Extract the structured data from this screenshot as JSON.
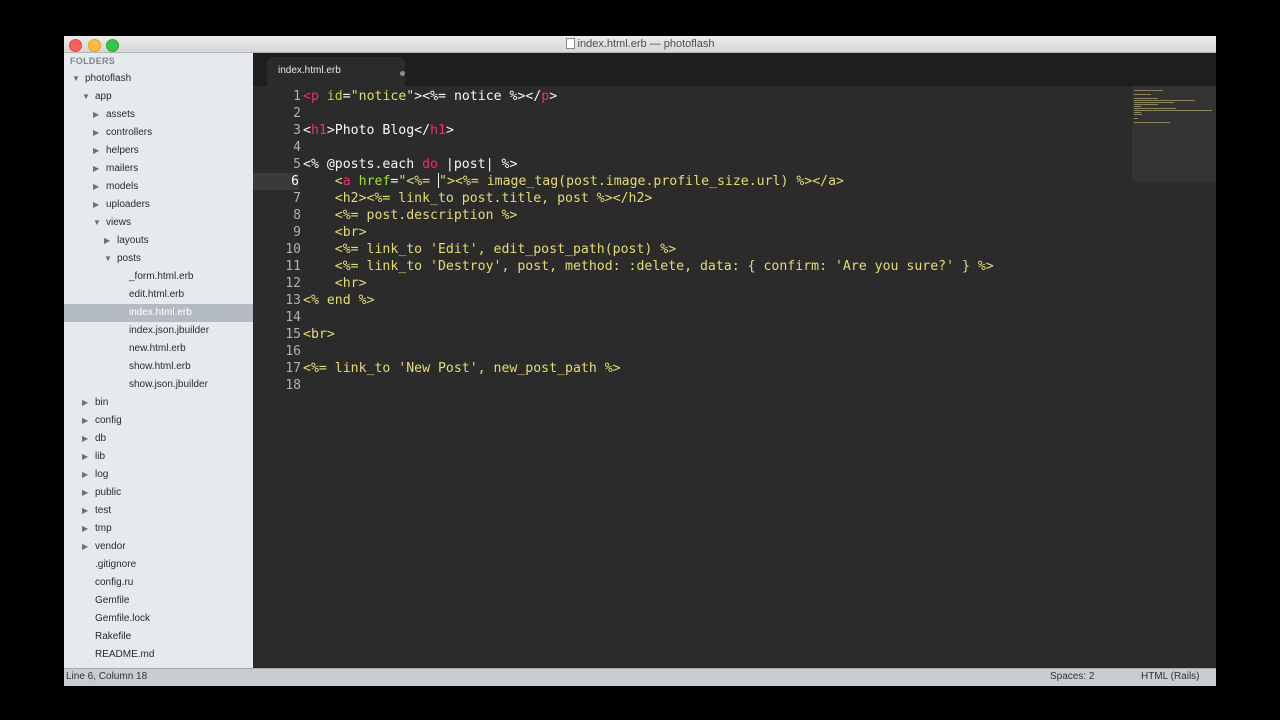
{
  "window": {
    "title": "index.html.erb — photoflash"
  },
  "sidebar": {
    "header": "FOLDERS",
    "tree": [
      {
        "label": "photoflash",
        "depth": 0,
        "type": "open"
      },
      {
        "label": "app",
        "depth": 1,
        "type": "open"
      },
      {
        "label": "assets",
        "depth": 2,
        "type": "closed"
      },
      {
        "label": "controllers",
        "depth": 2,
        "type": "closed"
      },
      {
        "label": "helpers",
        "depth": 2,
        "type": "closed"
      },
      {
        "label": "mailers",
        "depth": 2,
        "type": "closed"
      },
      {
        "label": "models",
        "depth": 2,
        "type": "closed"
      },
      {
        "label": "uploaders",
        "depth": 2,
        "type": "closed"
      },
      {
        "label": "views",
        "depth": 2,
        "type": "open"
      },
      {
        "label": "layouts",
        "depth": 3,
        "type": "closed"
      },
      {
        "label": "posts",
        "depth": 3,
        "type": "open"
      },
      {
        "label": "_form.html.erb",
        "depth": 4,
        "type": "file"
      },
      {
        "label": "edit.html.erb",
        "depth": 4,
        "type": "file"
      },
      {
        "label": "index.html.erb",
        "depth": 4,
        "type": "file",
        "selected": true
      },
      {
        "label": "index.json.jbuilder",
        "depth": 4,
        "type": "file"
      },
      {
        "label": "new.html.erb",
        "depth": 4,
        "type": "file"
      },
      {
        "label": "show.html.erb",
        "depth": 4,
        "type": "file"
      },
      {
        "label": "show.json.jbuilder",
        "depth": 4,
        "type": "file"
      },
      {
        "label": "bin",
        "depth": 1,
        "type": "closed"
      },
      {
        "label": "config",
        "depth": 1,
        "type": "closed"
      },
      {
        "label": "db",
        "depth": 1,
        "type": "closed"
      },
      {
        "label": "lib",
        "depth": 1,
        "type": "closed"
      },
      {
        "label": "log",
        "depth": 1,
        "type": "closed"
      },
      {
        "label": "public",
        "depth": 1,
        "type": "closed"
      },
      {
        "label": "test",
        "depth": 1,
        "type": "closed"
      },
      {
        "label": "tmp",
        "depth": 1,
        "type": "closed"
      },
      {
        "label": "vendor",
        "depth": 1,
        "type": "closed"
      },
      {
        "label": ".gitignore",
        "depth": 1,
        "type": "file"
      },
      {
        "label": "config.ru",
        "depth": 1,
        "type": "file"
      },
      {
        "label": "Gemfile",
        "depth": 1,
        "type": "file"
      },
      {
        "label": "Gemfile.lock",
        "depth": 1,
        "type": "file"
      },
      {
        "label": "Rakefile",
        "depth": 1,
        "type": "file"
      },
      {
        "label": "README.md",
        "depth": 1,
        "type": "file"
      }
    ]
  },
  "tabs": [
    {
      "label": "index.html.erb",
      "active": true,
      "dirty": true
    }
  ],
  "editor": {
    "current_line": 6,
    "lines": [
      [
        [
          "tag",
          "<"
        ],
        [
          "kw",
          "p"
        ],
        [
          "txt",
          " "
        ],
        [
          "attr",
          "id"
        ],
        [
          "txt",
          "="
        ],
        [
          "str",
          "\"notice\""
        ],
        [
          "txt",
          ">"
        ],
        [
          "erb",
          "<%= notice %>"
        ],
        [
          "txt",
          "</"
        ],
        [
          "kw",
          "p"
        ],
        [
          "txt",
          ">"
        ]
      ],
      [],
      [
        [
          "txt",
          "<"
        ],
        [
          "kw",
          "h1"
        ],
        [
          "txt",
          ">Photo Blog</"
        ],
        [
          "kw",
          "h1"
        ],
        [
          "txt",
          ">"
        ]
      ],
      [],
      [
        [
          "erb",
          "<% @posts.each "
        ],
        [
          "kw",
          "do"
        ],
        [
          "erb",
          " |post| %>"
        ]
      ],
      [
        [
          "txt",
          "    "
        ],
        [
          "ruby",
          "<"
        ],
        [
          "kw",
          "a"
        ],
        [
          "txt",
          " "
        ],
        [
          "attr",
          "href"
        ],
        [
          "txt",
          "="
        ],
        [
          "str",
          "\"<%= "
        ],
        [
          "cursor",
          ""
        ],
        [
          "str",
          "\""
        ],
        [
          "ruby",
          "><%= image_tag(post.image.profile_size.url) %></a>"
        ]
      ],
      [
        [
          "ruby",
          "    <h2><%= link_to post.title, post %></h2>"
        ]
      ],
      [
        [
          "ruby",
          "    <%= post.description %>"
        ]
      ],
      [
        [
          "ruby",
          "    <br>"
        ]
      ],
      [
        [
          "ruby",
          "    <%= link_to 'Edit', edit_post_path(post) %>"
        ]
      ],
      [
        [
          "ruby",
          "    <%= link_to 'Destroy', post, method: :delete, data: { confirm: 'Are you sure?' } %>"
        ]
      ],
      [
        [
          "ruby",
          "    <hr>"
        ]
      ],
      [
        [
          "ruby",
          "<% end %>"
        ]
      ],
      [],
      [
        [
          "ruby",
          "<br>"
        ]
      ],
      [],
      [
        [
          "ruby",
          "<%= link_to 'New Post', new_post_path %>"
        ]
      ],
      []
    ]
  },
  "status": {
    "position": "Line 6, Column 18",
    "indentation": "Spaces: 2",
    "syntax": "HTML (Rails)"
  }
}
